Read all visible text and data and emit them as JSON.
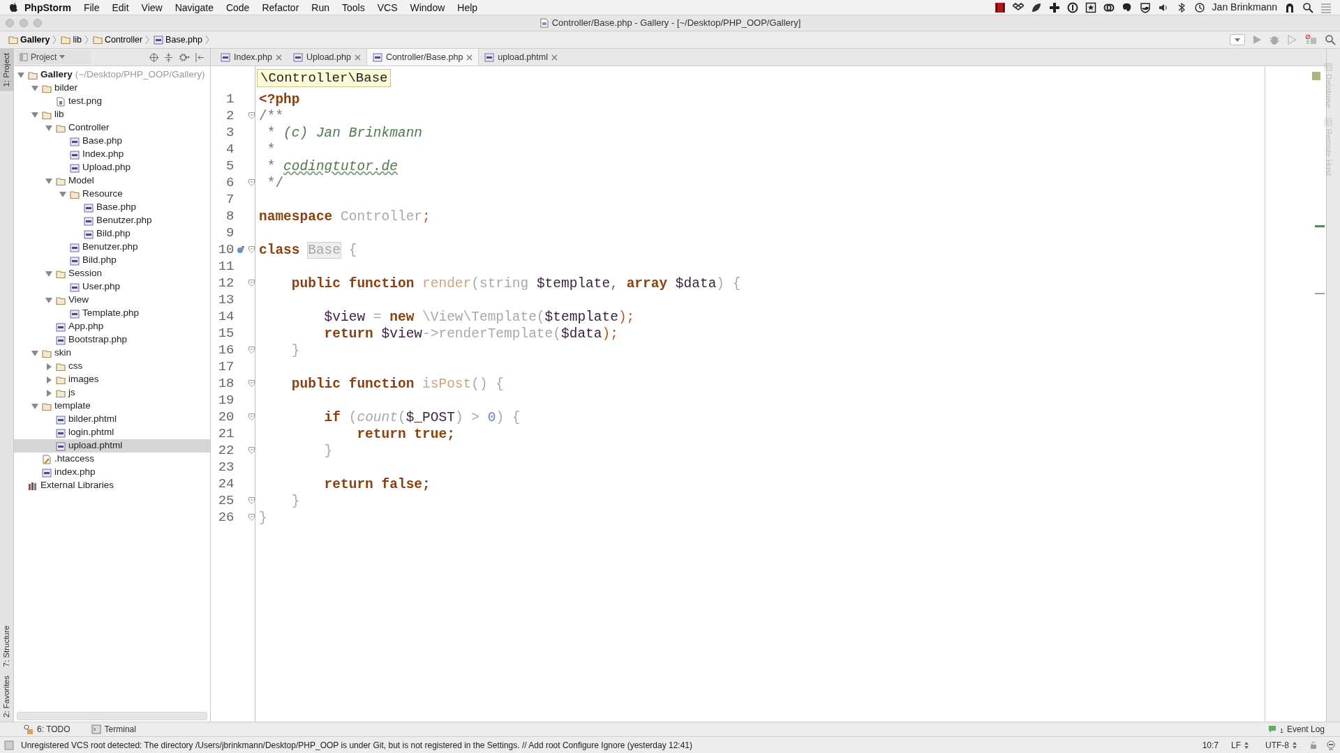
{
  "menu_bar": {
    "app": "PhpStorm",
    "items": [
      "File",
      "Edit",
      "View",
      "Navigate",
      "Code",
      "Refactor",
      "Run",
      "Tools",
      "VCS",
      "Window",
      "Help"
    ],
    "user": "Jan Brinkmann"
  },
  "window": {
    "title": "Controller/Base.php - Gallery - [~/Desktop/PHP_OOP/Gallery]"
  },
  "breadcrumbs": [
    "Gallery",
    "lib",
    "Controller",
    "Base.php"
  ],
  "left_stripe": [
    {
      "label": "1: Project",
      "selected": true
    },
    {
      "label": "7: Structure",
      "selected": false
    },
    {
      "label": "2: Favorites",
      "selected": false
    }
  ],
  "right_stripe": [
    "Database",
    "Remote Host"
  ],
  "project_panel": {
    "title": "Project",
    "tree": [
      {
        "label": "Gallery",
        "path": "(~/Desktop/PHP_OOP/Gallery)",
        "kind": "folder",
        "expanded": true,
        "selected": false,
        "children": [
          {
            "label": "bilder",
            "kind": "folder",
            "expanded": true,
            "selected": false,
            "children": [
              {
                "label": "test.png",
                "kind": "image",
                "selected": false
              }
            ]
          },
          {
            "label": "lib",
            "kind": "folder",
            "expanded": true,
            "selected": false,
            "children": [
              {
                "label": "Controller",
                "kind": "folder",
                "expanded": true,
                "selected": false,
                "children": [
                  {
                    "label": "Base.php",
                    "kind": "php",
                    "selected": false
                  },
                  {
                    "label": "Index.php",
                    "kind": "php",
                    "selected": false
                  },
                  {
                    "label": "Upload.php",
                    "kind": "php",
                    "selected": false
                  }
                ]
              },
              {
                "label": "Model",
                "kind": "folder",
                "expanded": true,
                "selected": false,
                "children": [
                  {
                    "label": "Resource",
                    "kind": "folder",
                    "expanded": true,
                    "selected": false,
                    "children": [
                      {
                        "label": "Base.php",
                        "kind": "php",
                        "selected": false
                      },
                      {
                        "label": "Benutzer.php",
                        "kind": "php",
                        "selected": false
                      },
                      {
                        "label": "Bild.php",
                        "kind": "php",
                        "selected": false
                      }
                    ]
                  },
                  {
                    "label": "Benutzer.php",
                    "kind": "php",
                    "selected": false
                  },
                  {
                    "label": "Bild.php",
                    "kind": "php",
                    "selected": false
                  }
                ]
              },
              {
                "label": "Session",
                "kind": "folder",
                "expanded": true,
                "selected": false,
                "children": [
                  {
                    "label": "User.php",
                    "kind": "php",
                    "selected": false
                  }
                ]
              },
              {
                "label": "View",
                "kind": "folder",
                "expanded": true,
                "selected": false,
                "children": [
                  {
                    "label": "Template.php",
                    "kind": "php",
                    "selected": false
                  }
                ]
              },
              {
                "label": "App.php",
                "kind": "php",
                "selected": false
              },
              {
                "label": "Bootstrap.php",
                "kind": "php",
                "selected": false
              }
            ]
          },
          {
            "label": "skin",
            "kind": "folder",
            "expanded": true,
            "selected": false,
            "children": [
              {
                "label": "css",
                "kind": "folder",
                "expanded": false,
                "selected": false
              },
              {
                "label": "images",
                "kind": "folder",
                "expanded": false,
                "selected": false
              },
              {
                "label": "js",
                "kind": "folder",
                "expanded": false,
                "selected": false
              }
            ]
          },
          {
            "label": "template",
            "kind": "folder",
            "expanded": true,
            "selected": false,
            "children": [
              {
                "label": "bilder.phtml",
                "kind": "php",
                "selected": false
              },
              {
                "label": "login.phtml",
                "kind": "php",
                "selected": false
              },
              {
                "label": "upload.phtml",
                "kind": "php",
                "selected": true
              }
            ]
          },
          {
            "label": ".htaccess",
            "kind": "config",
            "selected": false
          },
          {
            "label": "index.php",
            "kind": "php",
            "selected": false
          }
        ]
      },
      {
        "label": "External Libraries",
        "kind": "library",
        "selected": false
      }
    ]
  },
  "tabs": [
    {
      "label": "Index.php",
      "selected": false
    },
    {
      "label": "Upload.php",
      "selected": false
    },
    {
      "label": "Controller/Base.php",
      "selected": true
    },
    {
      "label": "upload.phtml",
      "selected": false
    }
  ],
  "editor": {
    "sticky_header": "\\Controller\\Base",
    "lines": [
      {
        "number": "1",
        "fold": false,
        "gutter_icon": false,
        "tokens": [
          {
            "kind": "kw",
            "text": "<?php"
          }
        ]
      },
      {
        "number": "2",
        "fold": true,
        "gutter_icon": false,
        "tokens": [
          {
            "kind": "comment",
            "text": "/**"
          }
        ]
      },
      {
        "number": "3",
        "fold": false,
        "gutter_icon": false,
        "tokens": [
          {
            "kind": "comment",
            "text": " * "
          },
          {
            "kind": "doc",
            "text": "(c) Jan Brinkmann"
          }
        ]
      },
      {
        "number": "4",
        "fold": false,
        "gutter_icon": false,
        "tokens": [
          {
            "kind": "comment",
            "text": " *"
          }
        ]
      },
      {
        "number": "5",
        "fold": false,
        "gutter_icon": false,
        "tokens": [
          {
            "kind": "comment",
            "text": " * "
          },
          {
            "kind": "link",
            "text": "codingtutor.de"
          }
        ]
      },
      {
        "number": "6",
        "fold": true,
        "gutter_icon": false,
        "tokens": [
          {
            "kind": "comment",
            "text": " */"
          }
        ]
      },
      {
        "number": "7",
        "fold": false,
        "gutter_icon": false
      },
      {
        "number": "8",
        "fold": false,
        "gutter_icon": false,
        "tokens": [
          {
            "kind": "kw",
            "text": "namespace "
          },
          {
            "kind": "faded",
            "text": "Controller"
          },
          {
            "kind": "punct",
            "text": ";"
          }
        ]
      },
      {
        "number": "9",
        "fold": false,
        "gutter_icon": false
      },
      {
        "number": "10",
        "fold": true,
        "gutter_icon": true,
        "tokens": [
          {
            "kind": "kw",
            "text": "class "
          },
          {
            "kind": "highlight",
            "text": "Base"
          },
          {
            "kind": "faded",
            "text": " {"
          }
        ]
      },
      {
        "number": "11",
        "fold": false,
        "gutter_icon": false
      },
      {
        "number": "12",
        "fold": true,
        "gutter_icon": false,
        "tokens": [
          {
            "kind": "kw",
            "text": "    public function "
          },
          {
            "kind": "fn",
            "text": "render"
          },
          {
            "kind": "faded",
            "text": "(string "
          },
          {
            "kind": "var",
            "text": "$template"
          },
          {
            "kind": "punct",
            "text": ", "
          },
          {
            "kind": "kw",
            "text": "array "
          },
          {
            "kind": "var",
            "text": "$data"
          },
          {
            "kind": "faded",
            "text": ") {"
          }
        ]
      },
      {
        "number": "13",
        "fold": false,
        "gutter_icon": false
      },
      {
        "number": "14",
        "fold": false,
        "gutter_icon": false,
        "tokens": [
          {
            "kind": "var",
            "text": "        $view"
          },
          {
            "kind": "faded",
            "text": " = "
          },
          {
            "kind": "kw",
            "text": "new "
          },
          {
            "kind": "faded",
            "text": "\\View\\Template("
          },
          {
            "kind": "var",
            "text": "$template"
          },
          {
            "kind": "punct",
            "text": ");"
          }
        ]
      },
      {
        "number": "15",
        "fold": false,
        "gutter_icon": false,
        "tokens": [
          {
            "kind": "kw",
            "text": "        return "
          },
          {
            "kind": "var",
            "text": "$view"
          },
          {
            "kind": "faded",
            "text": "->renderTemplate("
          },
          {
            "kind": "var",
            "text": "$data"
          },
          {
            "kind": "punct",
            "text": ");"
          }
        ]
      },
      {
        "number": "16",
        "fold": true,
        "gutter_icon": false,
        "tokens": [
          {
            "kind": "faded",
            "text": "    }"
          }
        ]
      },
      {
        "number": "17",
        "fold": false,
        "gutter_icon": false
      },
      {
        "number": "18",
        "fold": true,
        "gutter_icon": false,
        "tokens": [
          {
            "kind": "kw",
            "text": "    public function "
          },
          {
            "kind": "fn",
            "text": "isPost"
          },
          {
            "kind": "faded",
            "text": "() {"
          }
        ]
      },
      {
        "number": "19",
        "fold": false,
        "gutter_icon": false
      },
      {
        "number": "20",
        "fold": true,
        "gutter_icon": false,
        "tokens": [
          {
            "kind": "kw",
            "text": "        if "
          },
          {
            "kind": "faded",
            "text": "("
          },
          {
            "kind": "call",
            "text": "count"
          },
          {
            "kind": "faded",
            "text": "("
          },
          {
            "kind": "var",
            "text": "$_POST"
          },
          {
            "kind": "faded",
            "text": ") > "
          },
          {
            "kind": "num",
            "text": "0"
          },
          {
            "kind": "faded",
            "text": ") {"
          }
        ]
      },
      {
        "number": "21",
        "fold": false,
        "gutter_icon": false,
        "tokens": [
          {
            "kind": "kw",
            "text": "            return true;"
          }
        ]
      },
      {
        "number": "22",
        "fold": true,
        "gutter_icon": false,
        "tokens": [
          {
            "kind": "faded",
            "text": "        }"
          }
        ]
      },
      {
        "number": "23",
        "fold": false,
        "gutter_icon": false
      },
      {
        "number": "24",
        "fold": false,
        "gutter_icon": false,
        "tokens": [
          {
            "kind": "kw",
            "text": "        return false;"
          }
        ]
      },
      {
        "number": "25",
        "fold": true,
        "gutter_icon": false,
        "tokens": [
          {
            "kind": "faded",
            "text": "    }"
          }
        ]
      },
      {
        "number": "26",
        "fold": true,
        "gutter_icon": false,
        "tokens": [
          {
            "kind": "faded",
            "text": "}"
          }
        ]
      }
    ]
  },
  "bottom_tools": [
    "6: TODO",
    "Terminal"
  ],
  "event_log": {
    "count": "1",
    "label": "Event Log"
  },
  "status_bar": {
    "message": "Unregistered VCS root detected: The directory /Users/jbrinkmann/Desktop/PHP_OOP is under Git, but is not registered in the Settings. // Add root  Configure  Ignore (yesterday 12:41)",
    "position": "10:7",
    "line_separator": "LF",
    "encoding": "UTF-8"
  }
}
